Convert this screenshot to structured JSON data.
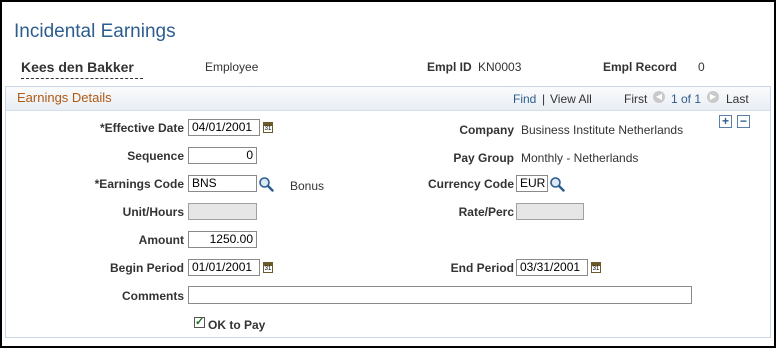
{
  "page": {
    "title": "Incidental Earnings"
  },
  "employee": {
    "name": "Kees den Bakker",
    "type": "Employee",
    "empl_id_label": "Empl ID",
    "empl_id": "KN0003",
    "empl_record_label": "Empl Record",
    "empl_record": "0"
  },
  "section": {
    "title": "Earnings Details",
    "find": "Find",
    "separator": "|",
    "view_all": "View All",
    "first": "First",
    "pager": "1 of 1",
    "last": "Last"
  },
  "fields": {
    "effective_date": {
      "label": "*Effective Date",
      "value": "04/01/2001"
    },
    "sequence": {
      "label": "Sequence",
      "value": "0"
    },
    "earnings_code": {
      "label": "*Earnings Code",
      "value": "BNS",
      "description": "Bonus"
    },
    "unit_hours": {
      "label": "Unit/Hours",
      "value": ""
    },
    "amount": {
      "label": "Amount",
      "value": "1250.00"
    },
    "begin_period": {
      "label": "Begin Period",
      "value": "01/01/2001"
    },
    "comments": {
      "label": "Comments",
      "value": ""
    },
    "ok_to_pay": {
      "label": "OK to Pay",
      "checked": true
    },
    "company": {
      "label": "Company",
      "value": "Business Institute Netherlands"
    },
    "pay_group": {
      "label": "Pay Group",
      "value": "Monthly - Netherlands"
    },
    "currency_code": {
      "label": "Currency Code",
      "value": "EUR"
    },
    "rate_perc": {
      "label": "Rate/Perc",
      "value": ""
    },
    "end_period": {
      "label": "End Period",
      "value": "03/31/2001"
    }
  },
  "icons": {
    "calendar": "calendar-icon",
    "lookup": "magnifier-icon",
    "add": "plus-icon",
    "remove": "minus-icon",
    "prev": "left-arrow-icon",
    "next": "right-arrow-icon",
    "check": "checkmark-icon"
  },
  "colors": {
    "title": "#2d5d8e",
    "section_title": "#b05a14",
    "link": "#2d5d8e",
    "check": "#207020"
  }
}
